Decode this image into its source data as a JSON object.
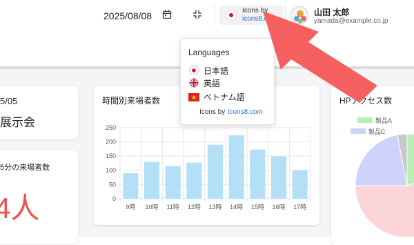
{
  "header": {
    "date": "2025/08/08",
    "icons_credit": {
      "prefix": "Icons by",
      "link": "icons8.com"
    },
    "user": {
      "name": "山田 太郎",
      "email": "yamada@example.co.jp"
    }
  },
  "cards": {
    "event": {
      "date": "5/05",
      "name": "展示会"
    },
    "visitors": {
      "label": "5分の来場者数",
      "value": "4人"
    },
    "hourly": {
      "title": "時間別来場者数"
    },
    "hp": {
      "title": "HPアクセス数"
    }
  },
  "language_popup": {
    "title": "Languages",
    "items": [
      {
        "label": "日本語",
        "icon": "flag-japan-icon"
      },
      {
        "label": "英語",
        "icon": "flag-uk-icon"
      },
      {
        "label": "ベトナム語",
        "icon": "flag-vietnam-icon"
      }
    ],
    "credit_prefix": "Icons by",
    "credit_link": "icons8.com"
  },
  "chart_data": [
    {
      "type": "bar",
      "categories": [
        "9時",
        "10時",
        "11時",
        "12時",
        "13時",
        "14時",
        "15時",
        "16時",
        "17時"
      ],
      "series": [
        {
          "values": [
            90,
            130,
            115,
            127,
            190,
            223,
            173,
            149,
            100
          ],
          "color": "#b3e0f7"
        }
      ],
      "ylim": [
        0,
        250
      ],
      "yticks": [
        0,
        50,
        100,
        150,
        200,
        250
      ],
      "grid": true
    },
    {
      "type": "pie",
      "legend": [
        {
          "label": "製品A",
          "color": "#b7f0b2"
        },
        {
          "label": "製品C",
          "color": "#cfd2fb"
        }
      ],
      "slices_colors": [
        "#b7f0b2",
        "#fbd5d8",
        "#cfd2fb",
        "#c8c8c8"
      ]
    }
  ],
  "colors": {
    "accent_link": "#2a6fd6",
    "highlight_value": "#f05050",
    "callout_arrow": "#f76060"
  }
}
